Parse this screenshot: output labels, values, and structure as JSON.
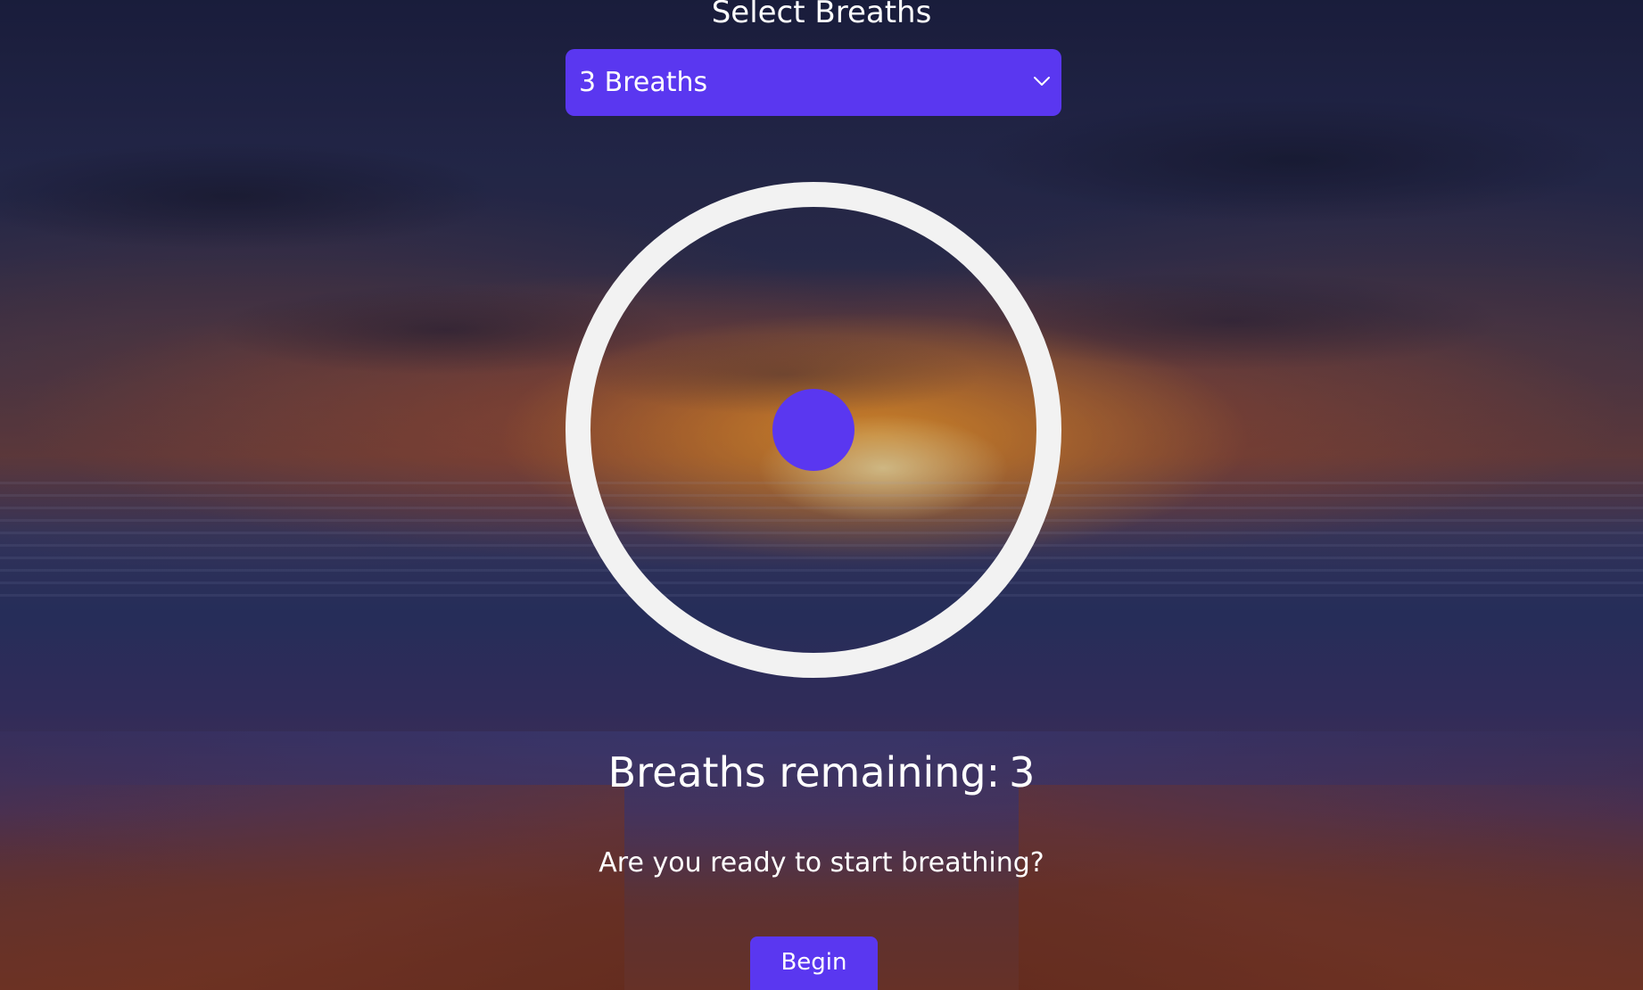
{
  "header": {
    "title": "Select Breaths"
  },
  "breath_select": {
    "selected_label": "3 Breaths",
    "icon": "chevron-down-icon"
  },
  "visualizer": {
    "ring_color": "#f2f2f2",
    "dot_color": "#5a37f0"
  },
  "status": {
    "remaining_label": "Breaths remaining:",
    "remaining_count": "3",
    "prompt": "Are you ready to start breathing?"
  },
  "actions": {
    "begin_label": "Begin"
  },
  "theme": {
    "accent": "#5a37f0",
    "text": "#ffffff"
  }
}
